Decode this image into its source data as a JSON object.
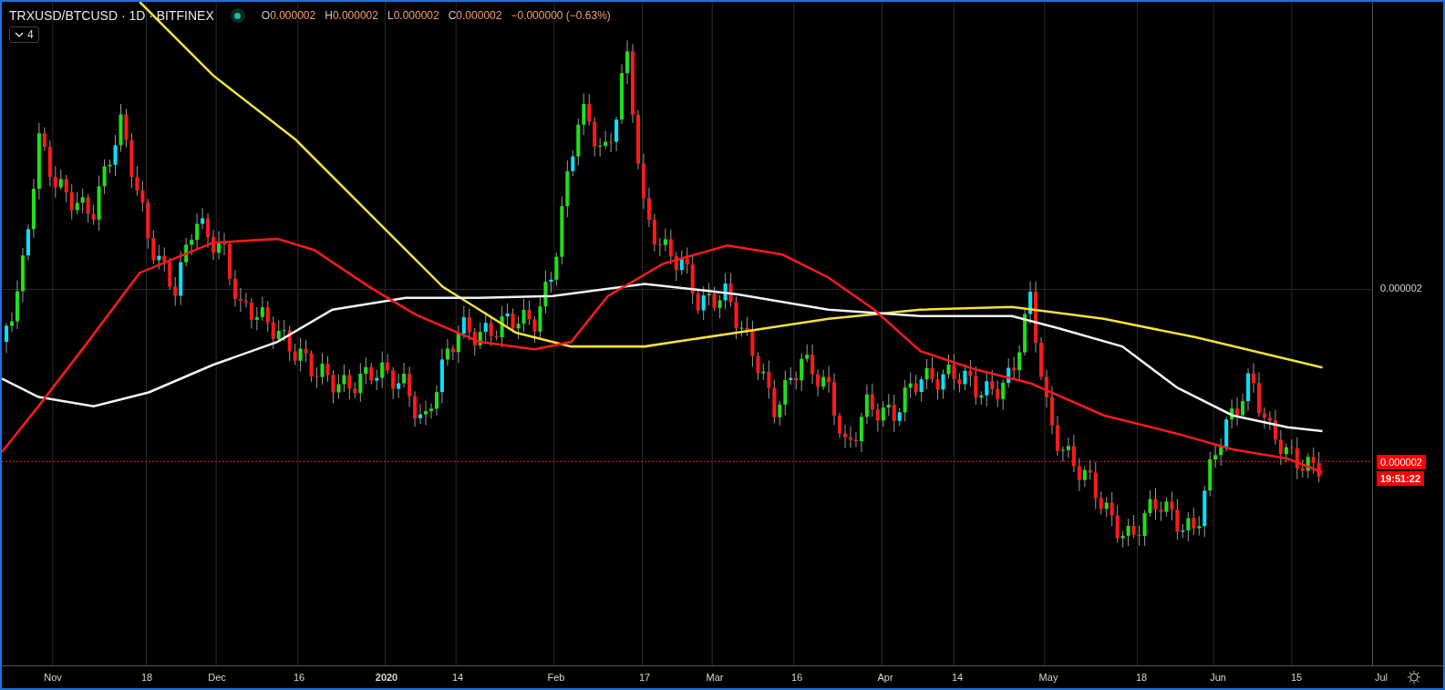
{
  "legend": {
    "title": "TRXUSD/BTCUSD · 1D · BITFINEX",
    "ohlc": [
      {
        "label": "O",
        "value": "0.000002"
      },
      {
        "label": "H",
        "value": "0.000002"
      },
      {
        "label": "L",
        "value": "0.000002"
      },
      {
        "label": "C",
        "value": "0.000002"
      }
    ],
    "change": "−0.000000 (−0.63%)"
  },
  "indicators_toggle": {
    "count": "4"
  },
  "price_axis": {
    "ticks": [
      "0.000002"
    ],
    "last_price": "0.000002",
    "countdown": "19:51:22"
  },
  "time_axis": {
    "labels": [
      {
        "text": "Nov",
        "kind": "tick"
      },
      {
        "text": "18",
        "kind": "tick"
      },
      {
        "text": "Dec",
        "kind": "tick"
      },
      {
        "text": "16",
        "kind": "tick"
      },
      {
        "text": "2020",
        "kind": "year"
      },
      {
        "text": "14",
        "kind": "tick"
      },
      {
        "text": "Feb",
        "kind": "tick"
      },
      {
        "text": "17",
        "kind": "tick"
      },
      {
        "text": "Mar",
        "kind": "tick"
      },
      {
        "text": "16",
        "kind": "tick"
      },
      {
        "text": "Apr",
        "kind": "tick"
      },
      {
        "text": "14",
        "kind": "tick"
      },
      {
        "text": "May",
        "kind": "tick"
      },
      {
        "text": "18",
        "kind": "tick"
      },
      {
        "text": "Jun",
        "kind": "tick"
      },
      {
        "text": "15",
        "kind": "tick"
      },
      {
        "text": "Jul",
        "kind": "tick"
      }
    ]
  }
}
